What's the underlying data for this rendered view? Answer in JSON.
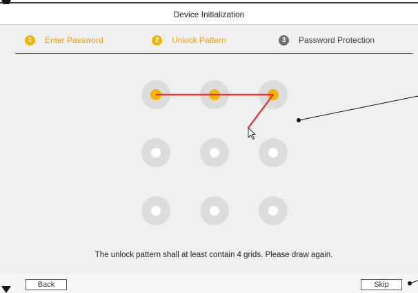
{
  "header": {
    "title": "Device Initialization"
  },
  "steps": [
    {
      "number": "1",
      "label": "Enter Password",
      "state": "completed"
    },
    {
      "number": "2",
      "label": "Unlock Pattern",
      "state": "current"
    },
    {
      "number": "3",
      "label": "Password Protection",
      "state": "pending"
    }
  ],
  "pattern": {
    "selected_dots": [
      1,
      2,
      3
    ],
    "colors": {
      "dot_bg": "#dcdcdc",
      "selected": "#f5b400",
      "line": "#e03a3a",
      "center": "#ffffff"
    }
  },
  "message": "The unlock pattern shall at least contain 4 grids. Please draw again.",
  "footer": {
    "back_label": "Back",
    "skip_label": "Skip"
  }
}
